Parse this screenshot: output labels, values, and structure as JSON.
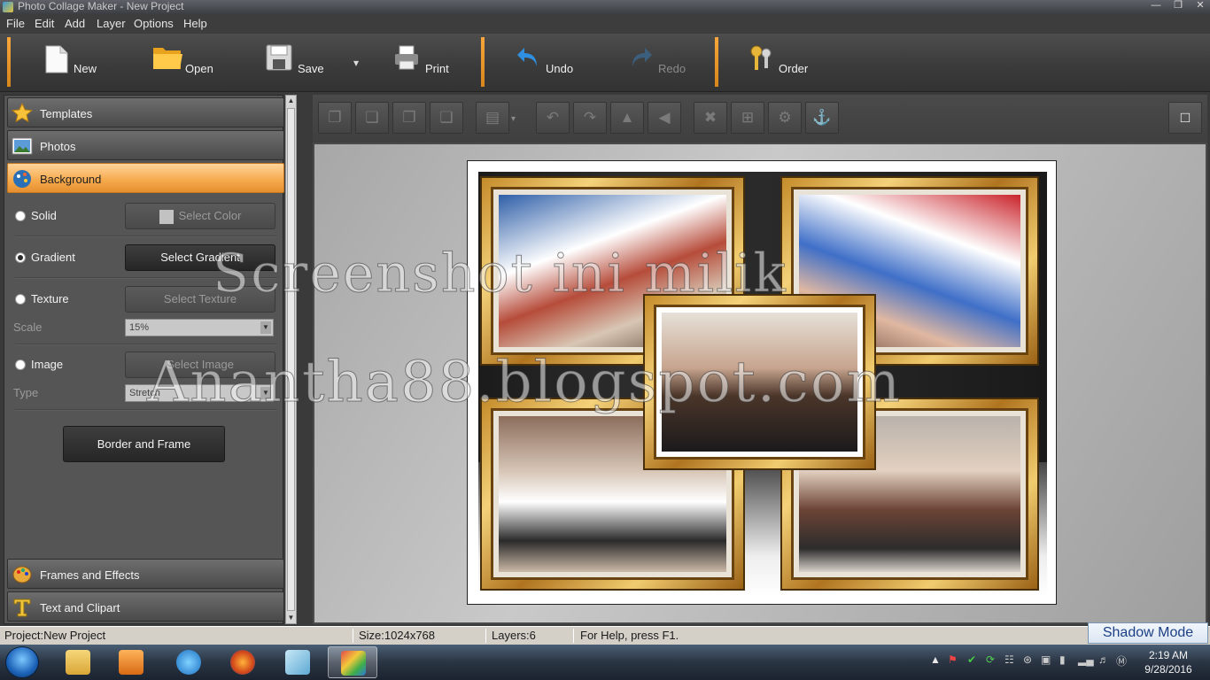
{
  "window": {
    "title": "Photo Collage Maker - New Project"
  },
  "menu": [
    "File",
    "Edit",
    "Add",
    "Layer",
    "Options",
    "Help"
  ],
  "toolbar": {
    "new": "New",
    "open": "Open",
    "save": "Save",
    "print": "Print",
    "undo": "Undo",
    "redo": "Redo",
    "order": "Order"
  },
  "sidebar": {
    "templates": "Templates",
    "photos": "Photos",
    "background": "Background",
    "frames_effects": "Frames and Effects",
    "text_clipart": "Text and Clipart"
  },
  "background_panel": {
    "solid_label": "Solid",
    "select_color": "Select Color",
    "gradient_label": "Gradient",
    "select_gradient": "Select Gradient",
    "texture_label": "Texture",
    "select_texture": "Select Texture",
    "scale_label": "Scale",
    "scale_value": "15%",
    "image_label": "Image",
    "select_image": "Select Image",
    "type_label": "Type",
    "type_value": "Stretch",
    "border_frame": "Border and Frame",
    "selected_mode": "Gradient"
  },
  "watermark": {
    "line1": "Screenshot ini milik",
    "line2": "Anantha88.blogspot.com"
  },
  "status": {
    "project": "Project:New Project",
    "size": "Size:1024x768",
    "layers": "Layers:6",
    "help": "For Help, press F1."
  },
  "shadow_mode": "Shadow Mode",
  "clock": {
    "time": "2:19 AM",
    "date": "9/28/2016"
  },
  "colors": {
    "accent": "#f5a94b",
    "panel": "#555555",
    "taskbar": "#2a3442"
  }
}
